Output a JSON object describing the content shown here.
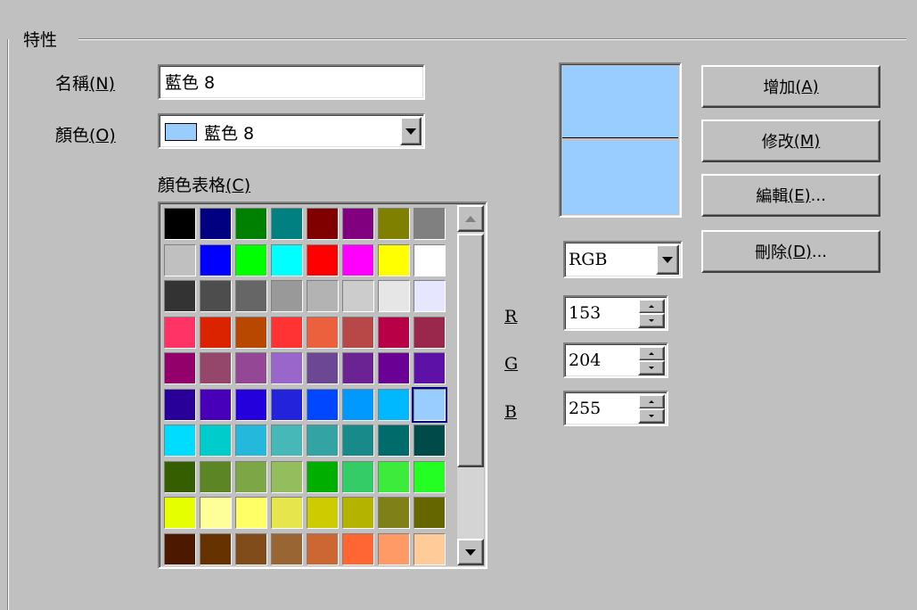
{
  "group_title": "特性",
  "name_label": "名稱",
  "name_key": "(N)",
  "name_value": "藍色 8",
  "color_label": "顏色",
  "color_key": "(O)",
  "color_value": "藍色 8",
  "table_label": "顏色表格",
  "table_key": "(C)",
  "mode_value": "RGB",
  "r_label": "R",
  "g_label": "G",
  "b_label": "B",
  "r_value": "153",
  "g_value": "204",
  "b_value": "255",
  "buttons": {
    "add_text": "增加",
    "add_key": "(A)",
    "modify_text": "修改",
    "modify_key": "(M)",
    "edit_text": "編輯",
    "edit_key": "(E)",
    "edit_suffix": "...",
    "delete_text": "刪除",
    "delete_key": "(D)",
    "delete_suffix": "..."
  },
  "current_color": "#99ccff",
  "palette": [
    [
      "#000000",
      "#000080",
      "#008000",
      "#008080",
      "#800000",
      "#800080",
      "#808000",
      "#808080"
    ],
    [
      "#c0c0c0",
      "#0000ff",
      "#00ff00",
      "#00ffff",
      "#ff0000",
      "#ff00ff",
      "#ffff00",
      "#ffffff"
    ],
    [
      "#333333",
      "#4d4d4d",
      "#666666",
      "#999999",
      "#b3b3b3",
      "#cccccc",
      "#e6e6e6",
      "#e6e6ff"
    ],
    [
      "#ff3366",
      "#dc2300",
      "#b84700",
      "#ff3333",
      "#eb613d",
      "#b84747",
      "#b80047",
      "#99284c"
    ],
    [
      "#94006b",
      "#94476b",
      "#944794",
      "#9966cc",
      "#6b4794",
      "#6b2394",
      "#6b0094",
      "#5e11a6"
    ],
    [
      "#280099",
      "#4700b8",
      "#2300dc",
      "#2323dc",
      "#0047ff",
      "#0099ff",
      "#00b8ff",
      "#99ccff"
    ],
    [
      "#00dcff",
      "#00cccc",
      "#23b8dc",
      "#47b8b8",
      "#33a3a3",
      "#198a8a",
      "#006b6b",
      "#004a4a"
    ],
    [
      "#355e00",
      "#5c8526",
      "#7da647",
      "#94bd5e",
      "#00ae00",
      "#33cc66",
      "#3deb3d",
      "#23ff23"
    ],
    [
      "#e6ff00",
      "#ffff99",
      "#ffff66",
      "#e6e64c",
      "#cccc00",
      "#b3b300",
      "#808019",
      "#666600"
    ],
    [
      "#4c1900",
      "#663300",
      "#804c19",
      "#996633",
      "#cc6633",
      "#ff6633",
      "#ff9966",
      "#ffcc99"
    ]
  ],
  "selected": {
    "row": 5,
    "col": 7
  }
}
